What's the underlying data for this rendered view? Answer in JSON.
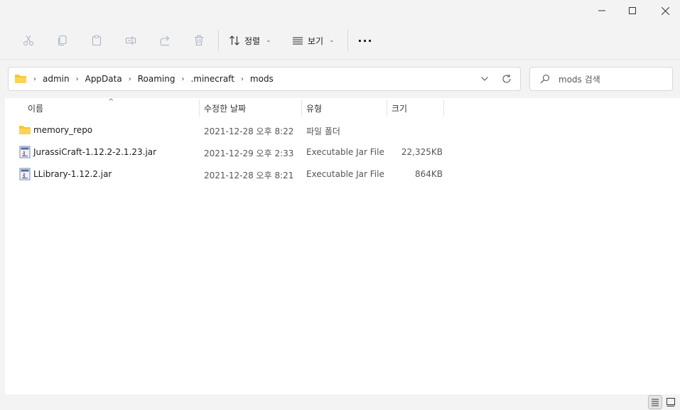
{
  "window": {
    "controls": {
      "minimize_icon": "minimize-icon",
      "maximize_icon": "maximize-icon",
      "close_icon": "close-icon"
    }
  },
  "toolbar": {
    "icons": [
      "cut-icon",
      "copy-icon",
      "paste-icon",
      "rename-icon",
      "share-icon",
      "delete-icon"
    ],
    "sort_label": "정렬",
    "view_label": "보기",
    "more_label": "···"
  },
  "address": {
    "crumbs": [
      "admin",
      "AppData",
      "Roaming",
      ".minecraft",
      "mods"
    ]
  },
  "search": {
    "placeholder": "mods 검색"
  },
  "columns": {
    "name": "이름",
    "date": "수정한 날짜",
    "type": "유형",
    "size": "크기"
  },
  "files": [
    {
      "name": "memory_repo",
      "date": "2021-12-28 오후 8:22",
      "type": "파일 폴더",
      "size": "",
      "icon": "folder-icon"
    },
    {
      "name": "JurassiCraft-1.12.2-2.1.23.jar",
      "date": "2021-12-29 오후 2:33",
      "type": "Executable Jar File",
      "size": "22,325KB",
      "icon": "jar-file-icon"
    },
    {
      "name": "LLibrary-1.12.2.jar",
      "date": "2021-12-28 오후 8:21",
      "type": "Executable Jar File",
      "size": "864KB",
      "icon": "jar-file-icon"
    }
  ],
  "colors": {
    "background": "#f3f3f3",
    "content": "#ffffff",
    "folder": "#f8c533"
  }
}
